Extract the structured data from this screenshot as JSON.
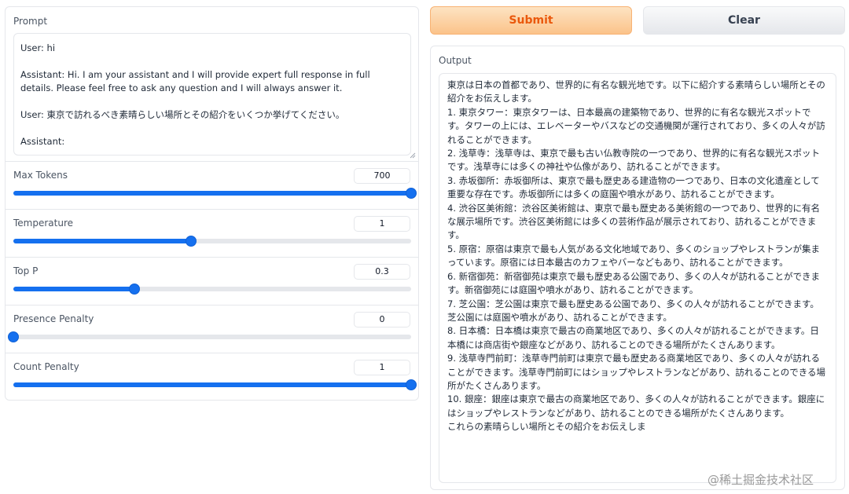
{
  "prompt": {
    "label": "Prompt",
    "value": "User: hi\n\nAssistant: Hi. I am your assistant and I will provide expert full response in full details. Please feel free to ask any question and I will always answer it.\n\nUser: 東京で訪れるべき素晴らしい場所とその紹介をいくつか挙げてください。\n\nAssistant:"
  },
  "sliders": [
    {
      "label": "Max Tokens",
      "value": "700",
      "fraction": 1.0
    },
    {
      "label": "Temperature",
      "value": "1",
      "fraction": 0.446
    },
    {
      "label": "Top P",
      "value": "0.3",
      "fraction": 0.304
    },
    {
      "label": "Presence Penalty",
      "value": "0",
      "fraction": 0.0
    },
    {
      "label": "Count Penalty",
      "value": "1",
      "fraction": 1.0
    }
  ],
  "buttons": {
    "submit": "Submit",
    "clear": "Clear"
  },
  "output": {
    "label": "Output",
    "text": "東京は日本の首都であり、世界的に有名な観光地です。以下に紹介する素晴らしい場所とその紹介をお伝えします。\n1. 東京タワー：東京タワーは、日本最高の建築物であり、世界的に有名な観光スポットです。タワーの上には、エレベーターやバスなどの交通機関が運行されており、多くの人々が訪れることができます。\n2. 浅草寺：浅草寺は、東京で最も古い仏教寺院の一つであり、世界的に有名な観光スポットです。浅草寺には多くの神社や仏像があり、訪れることができます。\n3. 赤坂御所：赤坂御所は、東京で最も歴史ある建造物の一つであり、日本の文化遺産として重要な存在です。赤坂御所には多くの庭園や噴水があり、訪れることができます。\n4. 渋谷区美術館：渋谷区美術館は、東京で最も歴史ある美術館の一つであり、世界的に有名な展示場所です。渋谷区美術館には多くの芸術作品が展示されており、訪れることができます。\n5. 原宿：原宿は東京で最も人気がある文化地域であり、多くのショップやレストランが集まっています。原宿には日本最古のカフェやバーなどもあり、訪れることができます。\n6. 新宿御苑：新宿御苑は東京で最も歴史ある公園であり、多くの人々が訪れることができます。新宿御苑には庭園や噴水があり、訪れることができます。\n7. 芝公園：芝公園は東京で最も歴史ある公園であり、多くの人々が訪れることができます。芝公園には庭園や噴水があり、訪れることができます。\n8. 日本橋：日本橋は東京で最古の商業地区であり、多くの人々が訪れることができます。日本橋には商店街や銀座などがあり、訪れることのできる場所がたくさんあります。\n9. 浅草寺門前町：浅草寺門前町は東京で最も歴史ある商業地区であり、多くの人々が訪れることができます。浅草寺門前町にはショップやレストランなどがあり、訪れることのできる場所がたくさんあります。\n10. 銀座：銀座は東京で最古の商業地区であり、多くの人々が訪れることができます。銀座にはショップやレストランなどがあり、訪れることのできる場所がたくさんあります。\nこれらの素晴らしい場所とその紹介をお伝えしま"
  },
  "watermark": "@稀土掘金技术社区",
  "colors": {
    "accent": "#1570ef",
    "submit_text": "#ea580c"
  }
}
